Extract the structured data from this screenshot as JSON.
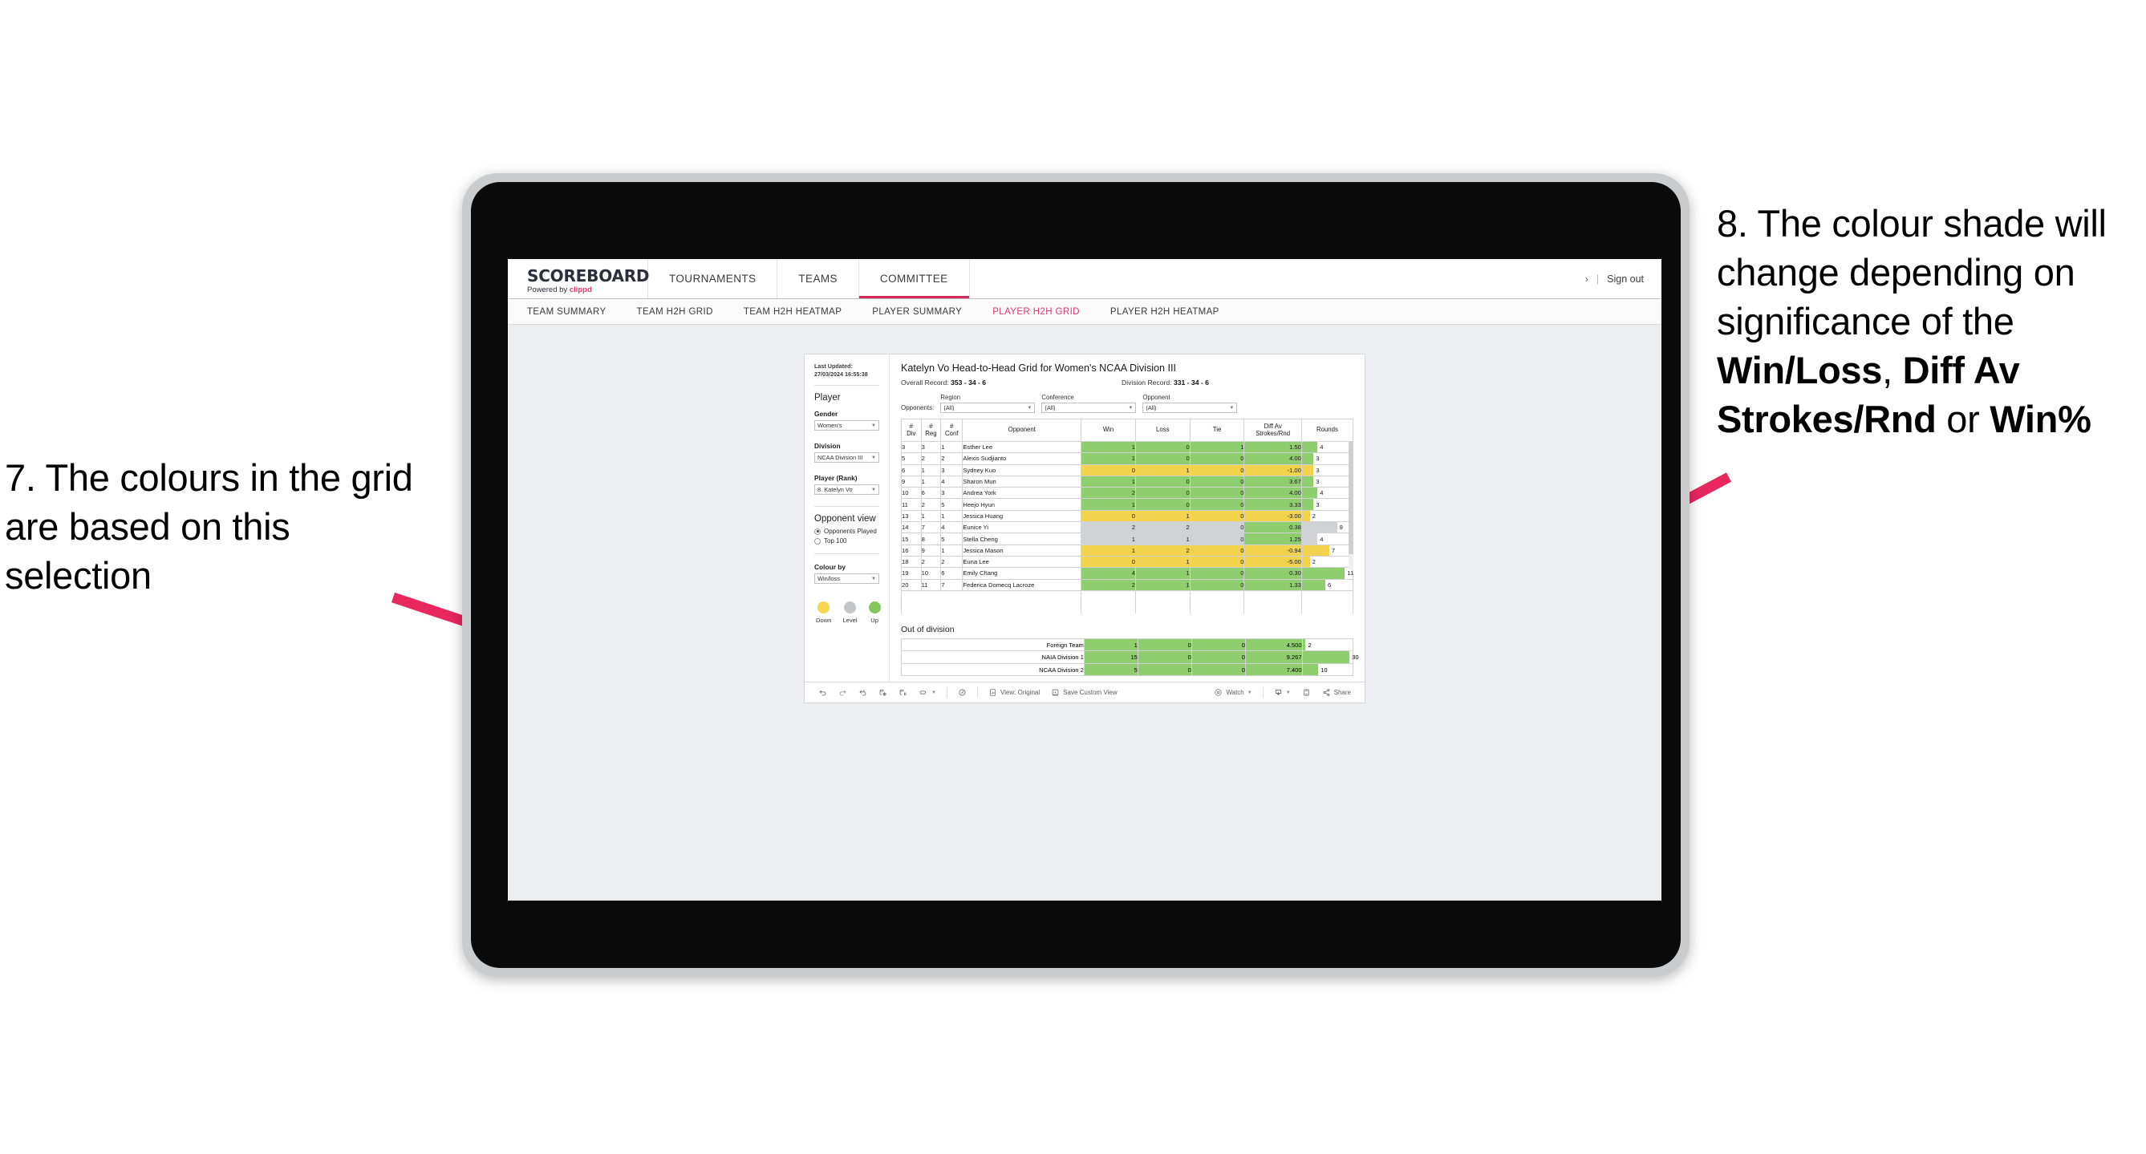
{
  "annotations": {
    "left": "7. The colours in the grid are based on this selection",
    "right_pre": "8. The colour shade will change depending on significance of the ",
    "right_b1": "Win/Loss",
    "right_mid1": ", ",
    "right_b2": "Diff Av Strokes/Rnd",
    "right_mid2": " or ",
    "right_b3": "Win%"
  },
  "app": {
    "brand_title": "SCOREBOARD",
    "brand_sub_pre": "Powered by ",
    "brand_sub_brand": "clippd",
    "nav_tabs": [
      {
        "label": "TOURNAMENTS",
        "active": false
      },
      {
        "label": "TEAMS",
        "active": false
      },
      {
        "label": "COMMITTEE",
        "active": true
      }
    ],
    "chevron": "›",
    "separator": "|",
    "sign_out": "Sign out",
    "sub_tabs": [
      {
        "label": "TEAM SUMMARY",
        "active": false
      },
      {
        "label": "TEAM H2H GRID",
        "active": false
      },
      {
        "label": "TEAM H2H HEATMAP",
        "active": false
      },
      {
        "label": "PLAYER SUMMARY",
        "active": false
      },
      {
        "label": "PLAYER H2H GRID",
        "active": true
      },
      {
        "label": "PLAYER H2H HEATMAP",
        "active": false
      }
    ]
  },
  "pane": {
    "last_updated": "Last Updated: 27/03/2024 16:55:38",
    "heading": "Player",
    "gender_label": "Gender",
    "gender_value": "Women's",
    "division_label": "Division",
    "division_value": "NCAA Division III",
    "player_label": "Player (Rank)",
    "player_value": "8. Katelyn Vo",
    "opponent_view_heading": "Opponent view",
    "opponent_view_options": [
      {
        "label": "Opponents Played",
        "selected": true
      },
      {
        "label": "Top 100",
        "selected": false
      }
    ],
    "colour_by_label": "Colour by",
    "colour_by_value": "Win/loss",
    "legend": [
      {
        "label": "Down",
        "color": "#f5d74e"
      },
      {
        "label": "Level",
        "color": "#c3c7cb"
      },
      {
        "label": "Up",
        "color": "#83c75d"
      }
    ]
  },
  "viz": {
    "title": "Katelyn Vo Head-to-Head Grid for Women's NCAA Division III",
    "overall_record_label": "Overall Record: ",
    "overall_record_value": "353 -  34 - 6",
    "division_record_label": "Division Record: ",
    "division_record_value": "331 -  34 - 6",
    "opponents_label": "Opponents:",
    "filters": [
      {
        "caption": "Region",
        "value": "(All)"
      },
      {
        "caption": "Conference",
        "value": "(All)"
      },
      {
        "caption": "Opponent",
        "value": "(All)"
      }
    ],
    "columns": [
      {
        "l1": "#",
        "l2": "Div"
      },
      {
        "l1": "#",
        "l2": "Reg"
      },
      {
        "l1": "#",
        "l2": "Conf"
      },
      {
        "l1": "Opponent",
        "l2": ""
      },
      {
        "l1": "Win",
        "l2": ""
      },
      {
        "l1": "Loss",
        "l2": ""
      },
      {
        "l1": "Tie",
        "l2": ""
      },
      {
        "l1": "Diff Av",
        "l2": "Strokes/Rnd"
      },
      {
        "l1": "Rounds",
        "l2": ""
      }
    ],
    "rows": [
      {
        "div": "3",
        "reg": "3",
        "conf": "1",
        "opponent": "Esther Lee",
        "win": "1",
        "loss": "0",
        "tie": "1",
        "diff": "1.50",
        "rounds": 4,
        "color": "up"
      },
      {
        "div": "5",
        "reg": "2",
        "conf": "2",
        "opponent": "Alexis Sudjianto",
        "win": "1",
        "loss": "0",
        "tie": "0",
        "diff": "4.00",
        "rounds": 3,
        "color": "up"
      },
      {
        "div": "6",
        "reg": "1",
        "conf": "3",
        "opponent": "Sydney Kuo",
        "win": "0",
        "loss": "1",
        "tie": "0",
        "diff": "-1.00",
        "rounds": 3,
        "color": "down"
      },
      {
        "div": "9",
        "reg": "1",
        "conf": "4",
        "opponent": "Sharon Mun",
        "win": "1",
        "loss": "0",
        "tie": "0",
        "diff": "3.67",
        "rounds": 3,
        "color": "up"
      },
      {
        "div": "10",
        "reg": "6",
        "conf": "3",
        "opponent": "Andrea York",
        "win": "2",
        "loss": "0",
        "tie": "0",
        "diff": "4.00",
        "rounds": 4,
        "color": "up"
      },
      {
        "div": "11",
        "reg": "2",
        "conf": "5",
        "opponent": "Heejo Hyun",
        "win": "1",
        "loss": "0",
        "tie": "0",
        "diff": "3.33",
        "rounds": 3,
        "color": "up"
      },
      {
        "div": "13",
        "reg": "1",
        "conf": "1",
        "opponent": "Jessica Huang",
        "win": "0",
        "loss": "1",
        "tie": "0",
        "diff": "-3.00",
        "rounds": 2,
        "color": "down"
      },
      {
        "div": "14",
        "reg": "7",
        "conf": "4",
        "opponent": "Eunice Yi",
        "win": "2",
        "loss": "2",
        "tie": "0",
        "diff": "0.38",
        "rounds": 9,
        "color": "level",
        "diff_color": "up"
      },
      {
        "div": "15",
        "reg": "8",
        "conf": "5",
        "opponent": "Stella Cheng",
        "win": "1",
        "loss": "1",
        "tie": "0",
        "diff": "1.25",
        "rounds": 4,
        "color": "level",
        "diff_color": "up"
      },
      {
        "div": "16",
        "reg": "9",
        "conf": "1",
        "opponent": "Jessica Mason",
        "win": "1",
        "loss": "2",
        "tie": "0",
        "diff": "-0.94",
        "rounds": 7,
        "color": "down"
      },
      {
        "div": "18",
        "reg": "2",
        "conf": "2",
        "opponent": "Euna Lee",
        "win": "0",
        "loss": "1",
        "tie": "0",
        "diff": "-5.00",
        "rounds": 2,
        "color": "down"
      },
      {
        "div": "19",
        "reg": "10",
        "conf": "6",
        "opponent": "Emily Chang",
        "win": "4",
        "loss": "1",
        "tie": "0",
        "diff": "0.30",
        "rounds": 11,
        "color": "up"
      },
      {
        "div": "20",
        "reg": "11",
        "conf": "7",
        "opponent": "Federica Domecq Lacroze",
        "win": "2",
        "loss": "1",
        "tie": "0",
        "diff": "1.33",
        "rounds": 6,
        "color": "up"
      }
    ],
    "rounds_max": 13,
    "out_of_division_title": "Out of division",
    "out_of_division_rows": [
      {
        "name": "Foreign Team",
        "win": "1",
        "loss": "0",
        "tie": "0",
        "diff": "4.500",
        "rounds": 2,
        "color": "up"
      },
      {
        "name": "NAIA Division 1",
        "win": "15",
        "loss": "0",
        "tie": "0",
        "diff": "9.267",
        "rounds": 30,
        "color": "up"
      },
      {
        "name": "NCAA Division 2",
        "win": "5",
        "loss": "0",
        "tie": "0",
        "diff": "7.400",
        "rounds": 10,
        "color": "up"
      }
    ],
    "ood_rounds_max": 32
  },
  "toolbar": {
    "view_label": "View: Original",
    "save_label": "Save Custom View",
    "watch_label": "Watch",
    "share_label": "Share"
  },
  "colors": {
    "accent": "#d4295a",
    "subtab_active": "#e0376b",
    "up": "#8fce6e",
    "down": "#f3d24e",
    "level": "#cfd3d6",
    "arrow": "#e8275f"
  },
  "chart_data": {
    "type": "table",
    "title": "Katelyn Vo Head-to-Head Grid for Women's NCAA Division III",
    "columns": [
      "# Div",
      "# Reg",
      "# Conf",
      "Opponent",
      "Win",
      "Loss",
      "Tie",
      "Diff Av Strokes/Rnd",
      "Rounds"
    ],
    "rows": [
      [
        "3",
        "3",
        "1",
        "Esther Lee",
        1,
        0,
        1,
        1.5,
        4
      ],
      [
        "5",
        "2",
        "2",
        "Alexis Sudjianto",
        1,
        0,
        0,
        4.0,
        3
      ],
      [
        "6",
        "1",
        "3",
        "Sydney Kuo",
        0,
        1,
        0,
        -1.0,
        3
      ],
      [
        "9",
        "1",
        "4",
        "Sharon Mun",
        1,
        0,
        0,
        3.67,
        3
      ],
      [
        "10",
        "6",
        "3",
        "Andrea York",
        2,
        0,
        0,
        4.0,
        4
      ],
      [
        "11",
        "2",
        "5",
        "Heejo Hyun",
        1,
        0,
        0,
        3.33,
        3
      ],
      [
        "13",
        "1",
        "1",
        "Jessica Huang",
        0,
        1,
        0,
        -3.0,
        2
      ],
      [
        "14",
        "7",
        "4",
        "Eunice Yi",
        2,
        2,
        0,
        0.38,
        9
      ],
      [
        "15",
        "8",
        "5",
        "Stella Cheng",
        1,
        1,
        0,
        1.25,
        4
      ],
      [
        "16",
        "9",
        "1",
        "Jessica Mason",
        1,
        2,
        0,
        -0.94,
        7
      ],
      [
        "18",
        "2",
        "2",
        "Euna Lee",
        0,
        1,
        0,
        -5.0,
        2
      ],
      [
        "19",
        "10",
        "6",
        "Emily Chang",
        4,
        1,
        0,
        0.3,
        11
      ],
      [
        "20",
        "11",
        "7",
        "Federica Domecq Lacroze",
        2,
        1,
        0,
        1.33,
        6
      ]
    ],
    "out_of_division": [
      [
        "Foreign Team",
        1,
        0,
        0,
        4.5,
        2
      ],
      [
        "NAIA Division 1",
        15,
        0,
        0,
        9.267,
        30
      ],
      [
        "NCAA Division 2",
        5,
        0,
        0,
        7.4,
        10
      ]
    ]
  }
}
